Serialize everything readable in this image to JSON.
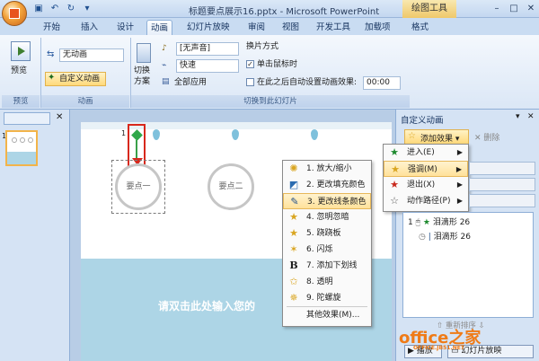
{
  "window": {
    "title": "标题要点展示16.pptx - Microsoft PowerPoint",
    "tool_tab": "绘图工具",
    "min": "–",
    "max": "□",
    "close": "✕"
  },
  "tabs": [
    "开始",
    "插入",
    "设计",
    "动画",
    "幻灯片放映",
    "审阅",
    "视图",
    "开发工具",
    "加载项",
    "格式"
  ],
  "ribbon": {
    "preview": {
      "button": "预览",
      "group": "预览"
    },
    "animation": {
      "combo_value": "无动画",
      "custom_button": "自定义动画",
      "group": "动画"
    },
    "transition": {
      "switch_scheme": "切换方案",
      "sound_value": "[无声音]",
      "speed_value": "快速",
      "apply_all": "全部应用",
      "mode_title": "换片方式",
      "on_click": "单击鼠标时",
      "auto_after": "在此之后自动设置动画效果:",
      "time_value": "00:00",
      "group": "切换到此幻灯片"
    }
  },
  "thumbs": {
    "slide_number": "1"
  },
  "slide": {
    "shape1": "要点一",
    "shape2": "要点二",
    "bottom_text": "请双击此处输入您的",
    "tag": "1"
  },
  "right_pane": {
    "title": "自定义动画",
    "add_effect": "添加效果 ▾",
    "delete": "删除",
    "entries": [
      {
        "num": "1",
        "name": "泪滴形 26"
      },
      {
        "num": "",
        "name": "泪滴形 26"
      }
    ],
    "reorder": "重新排序",
    "play": "播放",
    "slideshow": "幻灯片放映"
  },
  "effect_menu": [
    {
      "label": "进入(E)",
      "icon": "star-green-icon"
    },
    {
      "label": "强调(M)",
      "icon": "star-yellow-icon"
    },
    {
      "label": "退出(X)",
      "icon": "star-red-icon"
    },
    {
      "label": "动作路径(P)",
      "icon": "star-outline-icon"
    }
  ],
  "emphasis_menu": [
    "1. 放大/缩小",
    "2. 更改填充颜色",
    "3. 更改线条颜色",
    "4. 忽明忽暗",
    "5. 跷跷板",
    "6. 闪烁",
    "7. 添加下划线",
    "8. 透明",
    "9. 陀螺旋",
    "其他效果(M)..."
  ],
  "watermark": {
    "text": "office之家",
    "sub": "OFFICE.JB51.NET"
  },
  "colors": {
    "accent_red": "#d8281c",
    "highlight": "#ffe19a",
    "wave": "#add5e6"
  }
}
